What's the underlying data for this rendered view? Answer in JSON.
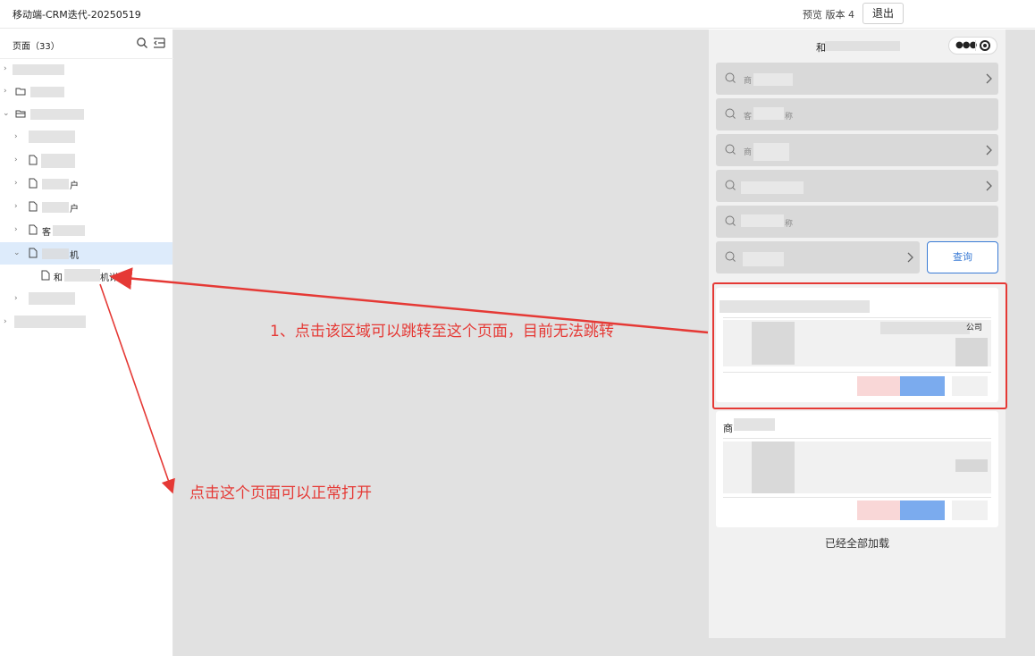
{
  "topbar": {
    "app_title": "移动端-CRM迭代-20250519",
    "preview_label": "预览 版本 4",
    "exit_label": "退出"
  },
  "sidebar": {
    "title": "页面（33）",
    "visible_item_labels": {
      "row2_suffix": "户",
      "row3_suffix": "户",
      "row4_prefix": "客",
      "row5_suffix": "机",
      "row6_prefix": "和",
      "row6_suffix": "机详情"
    }
  },
  "phone": {
    "header_glyph": "和",
    "fields": [
      {
        "placeholder": "商",
        "has_chevron": true
      },
      {
        "placeholder": "客",
        "suffix": "称",
        "has_chevron": false
      },
      {
        "placeholder": "商",
        "has_chevron": true
      },
      {
        "placeholder": "",
        "has_chevron": true
      },
      {
        "placeholder": "",
        "suffix": "称",
        "has_chevron": false
      },
      {
        "placeholder": "",
        "has_chevron": true
      }
    ],
    "query_label": "查询",
    "card1": {
      "company_suffix": "公司"
    },
    "card2": {
      "title_glyph": "商"
    },
    "loaded_text": "已经全部加载"
  },
  "annotations": {
    "note1": "1、点击该区域可以跳转至这个页面，目前无法跳转",
    "note2": "点击这个页面可以正常打开"
  },
  "colors": {
    "annotation_red": "#e53935",
    "selected_row": "#ddebfb",
    "link_blue": "#3a7bd5"
  }
}
